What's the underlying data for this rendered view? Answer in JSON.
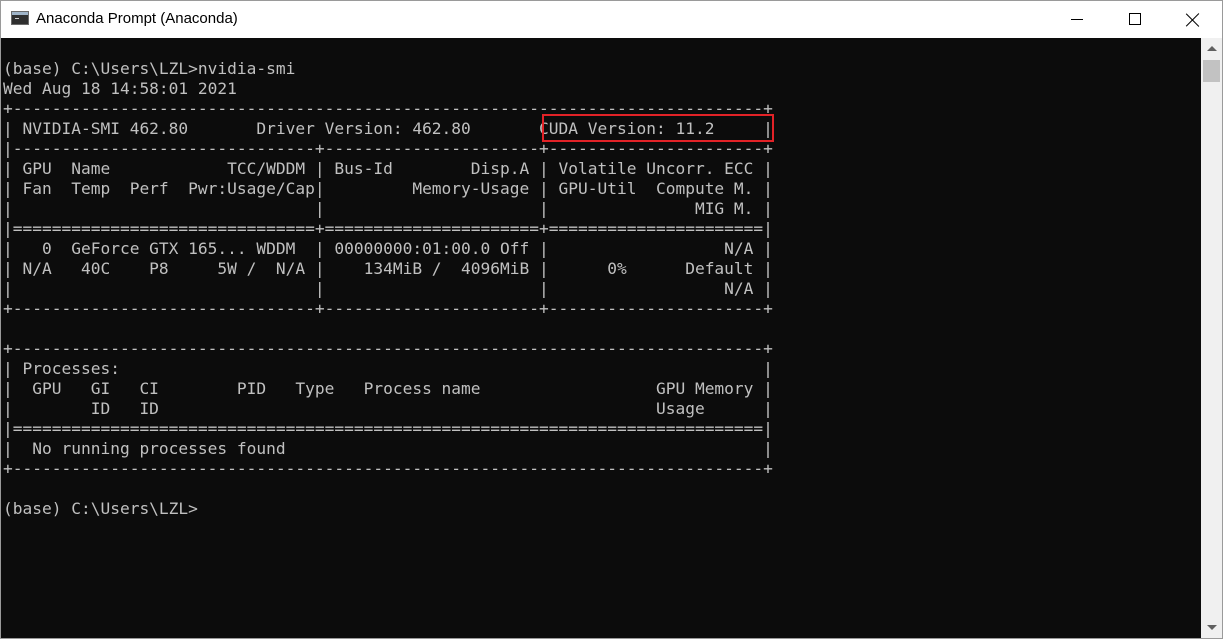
{
  "window": {
    "title": "Anaconda Prompt (Anaconda)",
    "icon": "console-icon"
  },
  "terminal": {
    "lines": [
      "(base) C:\\Users\\LZL>nvidia-smi",
      "Wed Aug 18 14:58:01 2021",
      "+-----------------------------------------------------------------------------+",
      "| NVIDIA-SMI 462.80       Driver Version: 462.80       CUDA Version: 11.2     |",
      "|-------------------------------+----------------------+----------------------+",
      "| GPU  Name            TCC/WDDM | Bus-Id        Disp.A | Volatile Uncorr. ECC |",
      "| Fan  Temp  Perf  Pwr:Usage/Cap|         Memory-Usage | GPU-Util  Compute M. |",
      "|                               |                      |               MIG M. |",
      "|===============================+======================+======================|",
      "|   0  GeForce GTX 165... WDDM  | 00000000:01:00.0 Off |                  N/A |",
      "| N/A   40C    P8     5W /  N/A |    134MiB /  4096MiB |      0%      Default |",
      "|                               |                      |                  N/A |",
      "+-------------------------------+----------------------+----------------------+",
      "",
      "+-----------------------------------------------------------------------------+",
      "| Processes:                                                                  |",
      "|  GPU   GI   CI        PID   Type   Process name                  GPU Memory |",
      "|        ID   ID                                                   Usage      |",
      "|=============================================================================|",
      "|  No running processes found                                                 |",
      "+-----------------------------------------------------------------------------+",
      "",
      "(base) C:\\Users\\LZL>"
    ],
    "highlight_text": "CUDA Version: 11.2",
    "highlight_color": "#e32227",
    "text_color": "#c0c0c0",
    "background_color": "#0c0c0c"
  }
}
